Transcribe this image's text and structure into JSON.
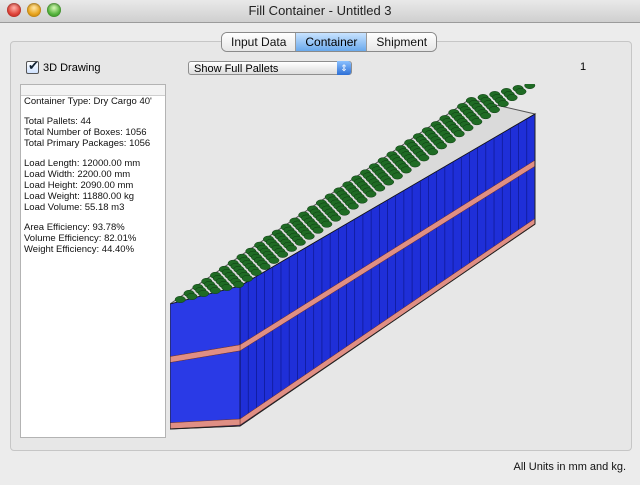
{
  "window": {
    "title": "Fill Container - Untitled 3"
  },
  "tabs": [
    {
      "label": "Input Data",
      "active": false
    },
    {
      "label": "Container",
      "active": true
    },
    {
      "label": "Shipment",
      "active": false
    }
  ],
  "toolbar": {
    "draw3d_label": "3D Drawing",
    "draw3d_checked": true,
    "pallet_select_value": "Show Full Pallets",
    "page_number": "1"
  },
  "info": {
    "container_type": "Container Type: Dry Cargo 40'",
    "total_pallets": "Total Pallets: 44",
    "total_boxes": "Total Number of Boxes: 1056",
    "total_primary": "Total Primary Packages: 1056",
    "load_length": "Load Length: 12000.00 mm",
    "load_width": "Load Width: 2200.00 mm",
    "load_height": "Load Height: 2090.00 mm",
    "load_weight": "Load Weight: 11880.00 kg",
    "load_volume": "Load Volume: 55.18 m3",
    "area_eff": "Area Efficiency: 93.78%",
    "volume_eff": "Volume Efficiency: 82.01%",
    "weight_eff": "Weight Efficiency: 44.40%"
  },
  "footer": {
    "units": "All Units in mm and kg."
  },
  "colors": {
    "box_blue": "#1f2fd8",
    "drum_green": "#1f6b24",
    "pallet_pink": "#e08f84",
    "active_tab": "#6aa9ec"
  }
}
